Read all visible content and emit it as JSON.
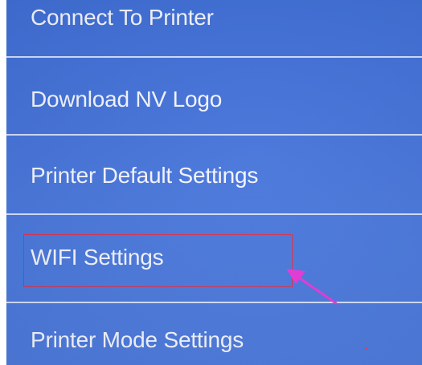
{
  "menu": {
    "items": [
      {
        "label": "Connect To Printer"
      },
      {
        "label": "Download NV Logo"
      },
      {
        "label": "Printer Default Settings"
      },
      {
        "label": "WIFI Settings",
        "highlighted": true
      },
      {
        "label": "Printer Mode Settings"
      }
    ]
  },
  "annotation": {
    "highlight_color": "#e0304a",
    "arrow_color": "#e63ad9",
    "arrow_target": "WIFI Settings"
  }
}
